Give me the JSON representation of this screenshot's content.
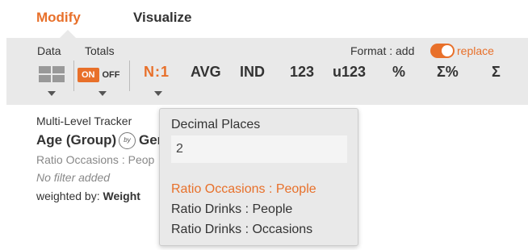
{
  "tabs": [
    {
      "label": "Modify",
      "active": true
    },
    {
      "label": "Visualize",
      "active": false
    }
  ],
  "toolbar": {
    "data_label": "Data",
    "totals_label": "Totals",
    "totals_on": "ON",
    "totals_off": "OFF",
    "format_label": "Format : add",
    "replace_label": "replace",
    "format_toggle": "replace",
    "buttons": [
      "N:1",
      "AVG",
      "IND",
      "123",
      "u123",
      "%",
      "Σ%",
      "Σ"
    ],
    "accent_color": "#e8702a"
  },
  "content": {
    "tracker_title": "Multi-Level Tracker",
    "heading_left": "Age (Group)",
    "by_icon_text": "by",
    "heading_right": "Ger",
    "subline": "Ratio Occasions : Peop",
    "no_filter": "No filter added",
    "weighted_prefix": "weighted by: ",
    "weighted_value": "Weight"
  },
  "popup": {
    "title": "Decimal Places",
    "decimal_value": "2",
    "options": [
      {
        "label": "Ratio Occasions : People",
        "selected": true
      },
      {
        "label": "Ratio Drinks : People",
        "selected": false
      },
      {
        "label": "Ratio Drinks : Occasions",
        "selected": false
      }
    ]
  }
}
